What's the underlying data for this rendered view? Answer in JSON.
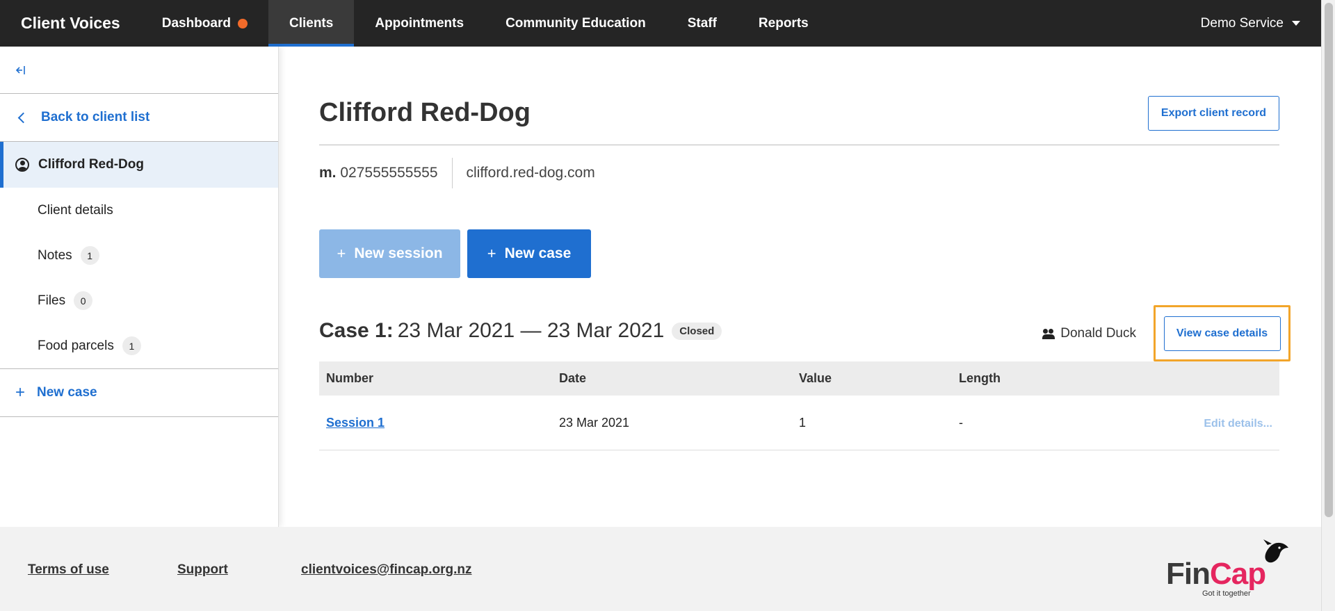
{
  "nav": {
    "brand": "Client Voices",
    "items": [
      {
        "label": "Dashboard"
      },
      {
        "label": "Clients"
      },
      {
        "label": "Appointments"
      },
      {
        "label": "Community Education"
      },
      {
        "label": "Staff"
      },
      {
        "label": "Reports"
      }
    ],
    "service": "Demo Service",
    "colors": {
      "bar": "#252525",
      "accent": "#1f6fd0",
      "notification_dot": "#f26b2a"
    }
  },
  "sidebar": {
    "collapse_icon": "collapse-left-icon",
    "back_label": "Back to client list",
    "client_name": "Clifford Red-Dog",
    "items": [
      {
        "label": "Client details",
        "count": null
      },
      {
        "label": "Notes",
        "count": "1"
      },
      {
        "label": "Files",
        "count": "0"
      },
      {
        "label": "Food parcels",
        "count": "1"
      }
    ],
    "new_case_label": "New case"
  },
  "client": {
    "name": "Clifford Red-Dog",
    "export_label": "Export client record",
    "mobile_prefix": "m.",
    "mobile": "027555555555",
    "email": "clifford.red-dog.com"
  },
  "actions": {
    "new_session": "New session",
    "new_case": "New case"
  },
  "case": {
    "label": "Case 1:",
    "date_range": "23 Mar 2021 — 23 Mar 2021",
    "status": "Closed",
    "assignee": "Donald Duck",
    "view_label": "View case details"
  },
  "table": {
    "headers": [
      "Number",
      "Date",
      "Value",
      "Length"
    ],
    "rows": [
      {
        "number": "Session 1",
        "date": "23 Mar 2021",
        "value": "1",
        "length": "-",
        "action": "Edit details..."
      }
    ]
  },
  "footer": {
    "links": [
      "Terms of use",
      "Support",
      "clientvoices@fincap.org.nz"
    ],
    "logo_text_fin": "Fin",
    "logo_text_cap": "Cap",
    "logo_tagline": "Got it together"
  }
}
